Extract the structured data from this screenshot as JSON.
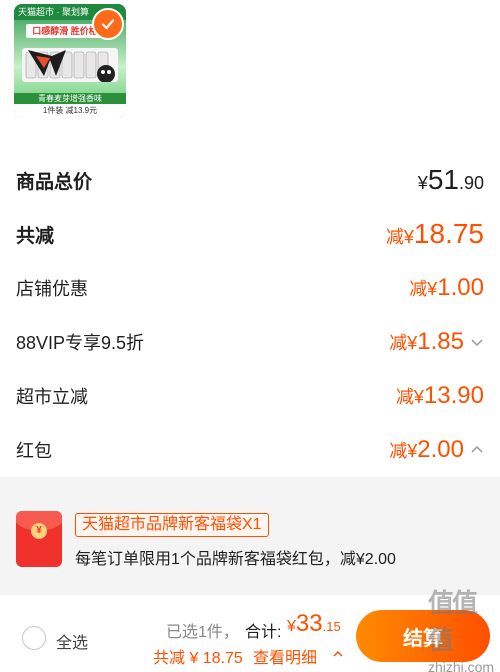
{
  "product": {
    "brand_strip": "天猫超市 · 聚划算",
    "slogan": "口感醇滑 胜价格",
    "flavor": "青春麦芽增强香味",
    "promo": "1件装 减13.9元"
  },
  "prices": {
    "subtotal": {
      "label": "商品总价",
      "currency": "¥",
      "int": "51",
      "dec": ".90"
    },
    "total_discount": {
      "label": "共减",
      "prefix": "减¥",
      "int": "18",
      "dec": ".75"
    },
    "store_coupon": {
      "label": "店铺优惠",
      "prefix": "减¥",
      "int": "1",
      "dec": ".00"
    },
    "vip": {
      "label": "88VIP专享9.5折",
      "prefix": "减¥",
      "int": "1",
      "dec": ".85"
    },
    "market": {
      "label": "超市立减",
      "prefix": "减¥",
      "int": "13",
      "dec": ".90"
    },
    "red_packet": {
      "label": "红包",
      "prefix": "减¥",
      "int": "2",
      "dec": ".00"
    }
  },
  "packet_panel": {
    "tag": "天猫超市品牌新客福袋X1",
    "desc": "每笔订单限用1个品牌新客福袋红包，减¥2.00",
    "coin": "¥"
  },
  "footer": {
    "select_all": "全选",
    "selected": "已选1件，",
    "total_label": "合计:",
    "total_currency": "¥",
    "total_int": "33",
    "total_dec": ".15",
    "save": "共减 ¥ 18.75",
    "detail": "查看明细",
    "checkout": "结算"
  },
  "watermark": {
    "main": "值值值",
    "sub": "zhizhi.com"
  },
  "colors": {
    "accent": "#ff5000",
    "brand_green": "#1f8a3f",
    "panel_bg": "#f4f4f4"
  }
}
